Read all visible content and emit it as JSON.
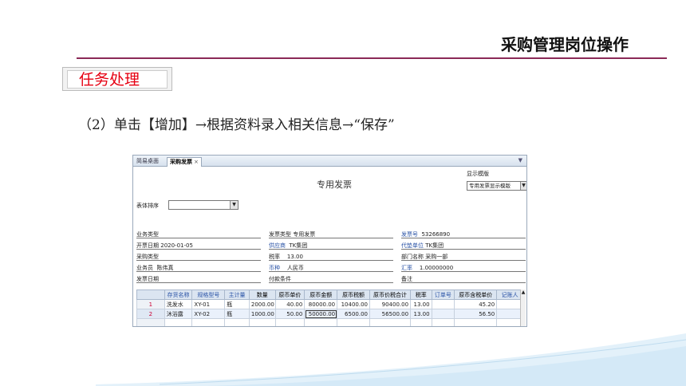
{
  "slide": {
    "title": "采购管理岗位操作",
    "task_label": "任务处理",
    "instruction": "（2）单击【增加】→根据资料录入相关信息→“保存”"
  },
  "app": {
    "tabs": [
      {
        "label": "简易桌面",
        "active": false
      },
      {
        "label": "采购发票",
        "active": true,
        "close": "×"
      }
    ],
    "tab_menu_icon": "▼",
    "form_title": "专用发票",
    "template_label": "显示模版",
    "template_value": "专用发票显示模版",
    "sort_label": "表体排序",
    "sort_value": "",
    "header_fields": {
      "biz_type": {
        "label": "业务类型",
        "value": ""
      },
      "invoice_type": {
        "label": "发票类型",
        "value": "专用发票"
      },
      "invoice_no": {
        "label": "发票号",
        "value": "53266890"
      },
      "invoice_date": {
        "label": "开票日期",
        "value": "2020-01-05"
      },
      "supplier": {
        "label": "供应商",
        "value": "TK集团"
      },
      "agent": {
        "label": "代垫单位",
        "value": "TK集团"
      },
      "purchase_type": {
        "label": "采购类型",
        "value": ""
      },
      "tax_rate": {
        "label": "税率",
        "value": "13.00"
      },
      "department": {
        "label": "部门名称",
        "value": "采购一部"
      },
      "salesman": {
        "label": "业务员",
        "value": "陈伟真"
      },
      "currency": {
        "label": "币种",
        "value": "人民币"
      },
      "exchange_rate": {
        "label": "汇率",
        "value": "1.00000000"
      },
      "arrival_date": {
        "label": "发票日期",
        "value": ""
      },
      "payment_terms": {
        "label": "付款条件",
        "value": ""
      },
      "remark": {
        "label": "备注",
        "value": ""
      }
    },
    "grid": {
      "columns": [
        "",
        "存货名称",
        "规格型号",
        "主计量",
        "数量",
        "原币单价",
        "原币金额",
        "原币税额",
        "原币价税合计",
        "税率",
        "订单号",
        "原币含税单价",
        "记账人"
      ],
      "rows": [
        [
          "1",
          "洗发水",
          "XY-01",
          "瓶",
          "2000.00",
          "40.00",
          "80000.00",
          "10400.00",
          "90400.00",
          "13.00",
          "",
          "45.20",
          ""
        ],
        [
          "2",
          "沐浴露",
          "XY-02",
          "瓶",
          "1000.00",
          "50.00",
          "50000.00",
          "6500.00",
          "56500.00",
          "13.00",
          "",
          "56.50",
          ""
        ]
      ]
    }
  }
}
